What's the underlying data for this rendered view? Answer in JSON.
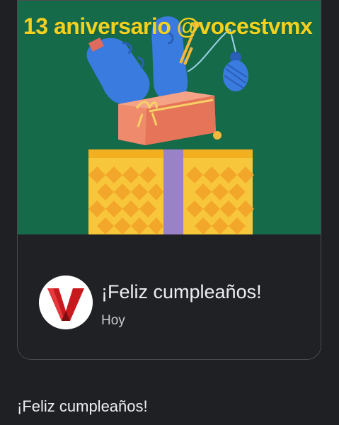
{
  "banner": {
    "text": "13 aniversario @vocestvmx",
    "image_description_icon": "gift-box-illustration-icon"
  },
  "notification": {
    "avatar_icon": "voces-tv-logo-icon",
    "title": "¡Feliz cumpleaños!",
    "subtitle": "Hoy"
  },
  "caption": "¡Feliz cumpleaños!",
  "colors": {
    "background": "#1f2023",
    "banner_green": "#156a4a",
    "banner_text": "#f4d11e",
    "card_border": "#4a4b4f"
  }
}
